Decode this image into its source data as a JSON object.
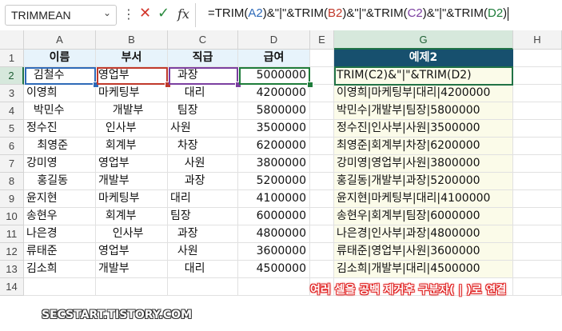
{
  "name_box": "TRIMMEAN",
  "formula_parts": [
    {
      "t": "=TRIM(",
      "c": ""
    },
    {
      "t": "A2",
      "c": "r-a2"
    },
    {
      "t": ")&\"|\"&TRIM(",
      "c": ""
    },
    {
      "t": "B2",
      "c": "r-b2"
    },
    {
      "t": ")&\"|\"&TRIM(",
      "c": ""
    },
    {
      "t": "C2",
      "c": "r-c2"
    },
    {
      "t": ")&\"|\"&TRIM(",
      "c": ""
    },
    {
      "t": "D2",
      "c": "r-d2"
    },
    {
      "t": ")",
      "c": ""
    }
  ],
  "columns": [
    "A",
    "B",
    "C",
    "D",
    "E",
    "G",
    "H"
  ],
  "rows": [
    "1",
    "2",
    "3",
    "4",
    "5",
    "6",
    "7",
    "8",
    "9",
    "10",
    "11",
    "12",
    "13",
    "14"
  ],
  "headers": {
    "name": "이름",
    "dept": "부서",
    "rank": "직급",
    "salary": "급여",
    "example": "예제2"
  },
  "data": [
    {
      "name": "  김철수",
      "dept": "영업부",
      "rank": "  과장",
      "salary": "5000000",
      "result": "TRIM(C2)&\"|\"&TRIM(D2)"
    },
    {
      "name": "이영희",
      "dept": "마케팅부",
      "rank": "    대리",
      "salary": "4200000",
      "result": "이영희|마케팅부|대리|4200000"
    },
    {
      "name": "  박민수",
      "dept": "    개발부",
      "rank": "  팀장",
      "salary": "5800000",
      "result": "박민수|개발부|팀장|5800000"
    },
    {
      "name": "정수진",
      "dept": "  인사부",
      "rank": "사원",
      "salary": "3500000",
      "result": "정수진|인사부|사원|3500000"
    },
    {
      "name": "   최영준",
      "dept": "  회계부",
      "rank": "  차장",
      "salary": "6200000",
      "result": "최영준|회계부|차장|6200000"
    },
    {
      "name": "강미영",
      "dept": "영업부",
      "rank": "    사원",
      "salary": "3800000",
      "result": "강미영|영업부|사원|3800000"
    },
    {
      "name": "   홍길동",
      "dept": "개발부",
      "rank": "    과장",
      "salary": "5200000",
      "result": "홍길동|개발부|과장|5200000"
    },
    {
      "name": "윤지현",
      "dept": "마케팅부",
      "rank": "대리",
      "salary": "4100000",
      "result": "윤지현|마케팅부|대리|4100000"
    },
    {
      "name": "송현우",
      "dept": "  회계부",
      "rank": "팀장",
      "salary": "6000000",
      "result": "송현우|회계부|팀장|6000000"
    },
    {
      "name": "나은경",
      "dept": "    인사부",
      "rank": "  과장",
      "salary": "4800000",
      "result": "나은경|인사부|과장|4800000"
    },
    {
      "name": "류태준",
      "dept": "영업부",
      "rank": "  사원",
      "salary": "3600000",
      "result": "류태준|영업부|사원|3600000"
    },
    {
      "name": "김소희",
      "dept": "개발부",
      "rank": "    대리",
      "salary": "4500000",
      "result": "김소희|개발부|대리|4500000"
    }
  ],
  "annotation": "여러 셀을 공백 제거후 구분자( | )로 연결",
  "watermark": "SECSTART.TISTORY.COM",
  "colors": {
    "accent": "#217346",
    "example_header": "#17506e",
    "ref_a2": "#2e6ab8",
    "ref_b2": "#c0392b",
    "ref_c2": "#7b3fa0",
    "ref_d2": "#1e7c3a"
  }
}
